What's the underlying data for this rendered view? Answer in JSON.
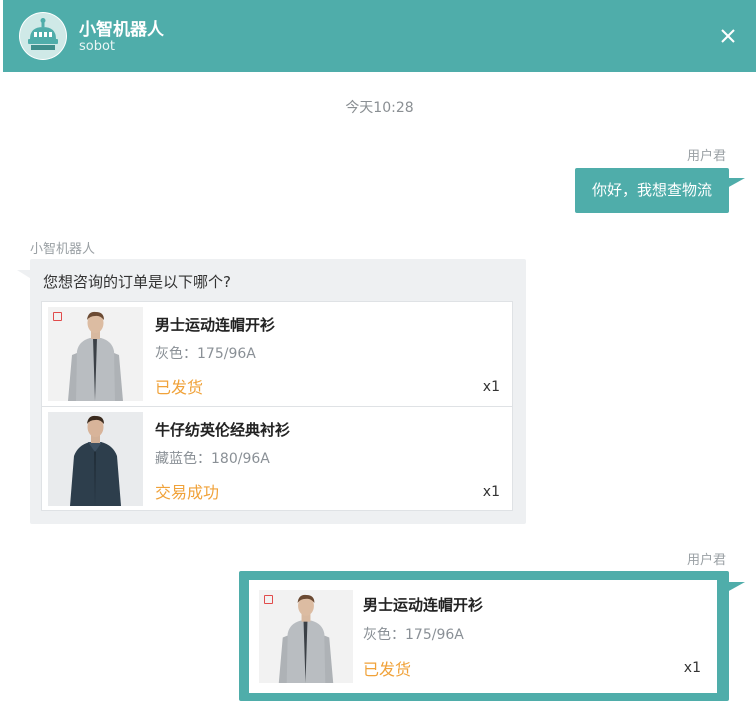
{
  "header": {
    "bot_name": "小智机器人",
    "bot_subtitle": "sobot",
    "close_label": "×",
    "color": "#4fadaa"
  },
  "chat": {
    "timestamp": "今天10:28",
    "messages": [
      {
        "sender": "用户君",
        "text": "你好，我想查物流"
      },
      {
        "sender": "小智机器人",
        "text": "您想咨询的订单是以下哪个?",
        "orders": [
          {
            "name": "男士运动连帽开衫",
            "spec": "灰色：175/96A",
            "status": "已发货",
            "qty": "x1",
            "jacket_color": "#b9bdc1"
          },
          {
            "name": "牛仔纺英伦经典衬衫",
            "spec": "藏蓝色：180/96A",
            "status": "交易成功",
            "qty": "x1",
            "jacket_color": "#2d3e4c"
          }
        ]
      },
      {
        "sender": "用户君",
        "selected_order": {
          "name": "男士运动连帽开衫",
          "spec": "灰色：175/96A",
          "status": "已发货",
          "qty": "x1",
          "jacket_color": "#b9bdc1"
        }
      }
    ]
  },
  "icons": {
    "avatar": "robot-avatar-icon",
    "close": "close-icon",
    "badge": "shop-badge-icon"
  },
  "colors": {
    "accent": "#4fadaa",
    "status_orange": "#f0a23a",
    "bot_bubble": "#eef0f2"
  }
}
